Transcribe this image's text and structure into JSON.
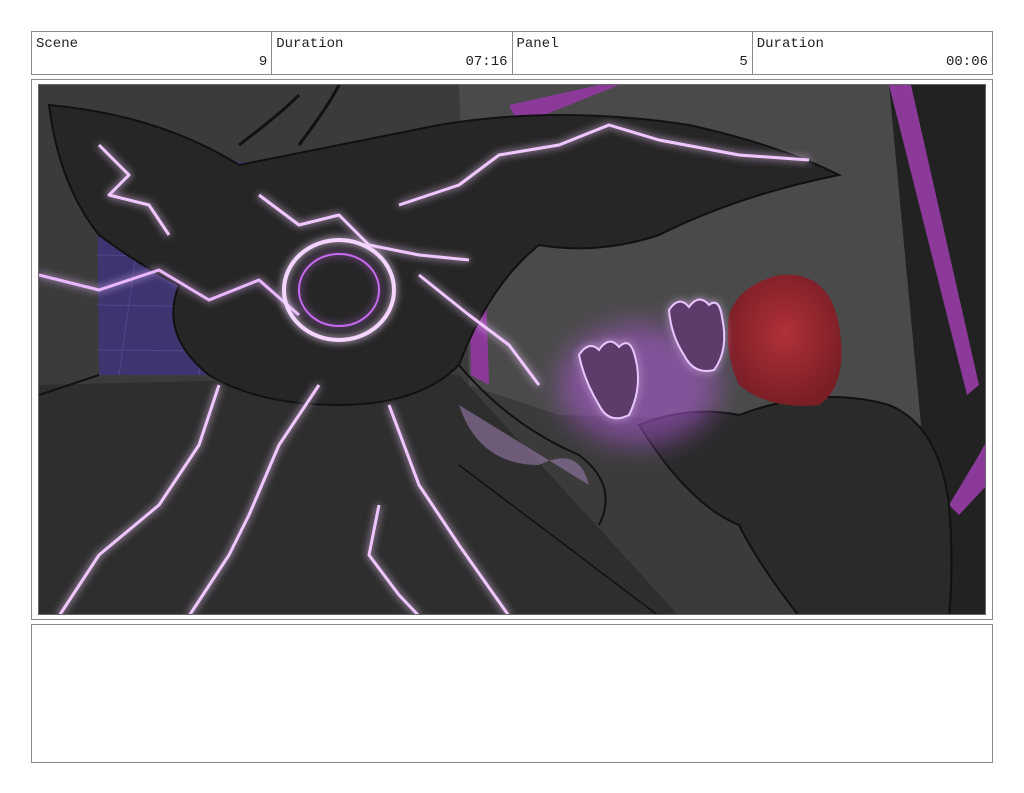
{
  "header": {
    "scene_label": "Scene",
    "scene_value": "9",
    "duration_label": "Duration",
    "duration_value": "07:16",
    "panel_label": "Panel",
    "panel_value": "5",
    "panel_duration_label": "Duration",
    "panel_duration_value": "00:06"
  },
  "panel_image": {
    "icon": "storyboard-sketch-image",
    "accent_color": "#c86bf0",
    "hood_color": "#a8272e"
  },
  "notes": {
    "text": ""
  }
}
